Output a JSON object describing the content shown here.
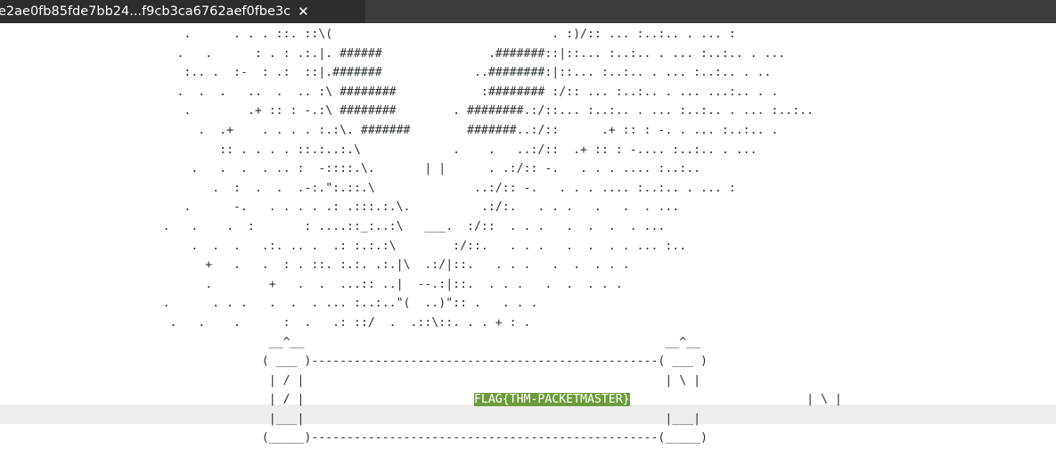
{
  "tab": {
    "title": "e2ae0fb85fde7bb24...f9cb3ca6762aef0fbe3c",
    "close_glyph": "✕"
  },
  "editor": {
    "art_lines": [
      "                          .      . . . ::. ::\\(                               . :)/:: ... :..:.. . ... :",
      "                         .   .      : . : .:.|. ######               .#######::|::... :..:.. . ... :..:.. . ...",
      "                          :.. .  :-  : .:  ::|.#######             ..########:|::... :..:.. . ... :..:.. . ..",
      "                         .  .  .   ..  .  .. :\\ ########            :######## :/:: ... :..:.. . ... ...:.. . .",
      "                          .        .+ :: : -.:\\ ########        . ########.:/::... :..:.. . ... :..:.. . ... :..:..",
      "                            .  .+    . . . . :.:\\. #######        #######..:/::      .+ :: : -. . ... :..:.. .",
      "                               :: . . . . ::.:..:.\\             .    .   ..:/::  .+ :: : -.... :..:.. . ...",
      "                           .   .  .  . .. :  -::::.\\.       | |      . .:/:: -.   . . . .... :..:..",
      "                              .  :  .  .  .-:.\":.::.\\              ..:/:: -.   . . . .... :..:.. . ... :",
      "                          .      -.   . . . . .: .:::.:.\\.          .:/:.   . . .   .   .  . ...",
      "                       .   .    .  :       : ....::_:..:\\   ___.  :/::  . . .   .  .  .  . ...",
      "                           .  .  .   .:. .. .  .: :.:.:\\        :/::.   . . .   .  .  . . ... :..",
      "                             +   .   .  : . ::. :.:. .:.|\\  .:/|::.   . . .   .  .  . . .",
      "                             .        +   .  .  ...:: ..|  --.:|::.  . . .   .  .  . . .",
      "                       .      . . .   .  .  . ... :..:..\"(  ..)\":: .   . . .",
      "                        .   .    .      :  .   .: ::/  .  .::\\::. . . + : .",
      "                                      __^__                                                   __^__",
      "                                     ( ___ )-------------------------------------------------( ___ )",
      "                                      | / |                                                   | \\ |"
    ],
    "flag_line_prefix": "                                      | / |                        ",
    "flag_text": "FLAG{THM-PACKETMASTER}",
    "flag_line_suffix": "                         | \\ |",
    "art_tail": [
      "                                      |___|                                                   |___|",
      "                                     (_____)-------------------------------------------------(_____)"
    ]
  }
}
